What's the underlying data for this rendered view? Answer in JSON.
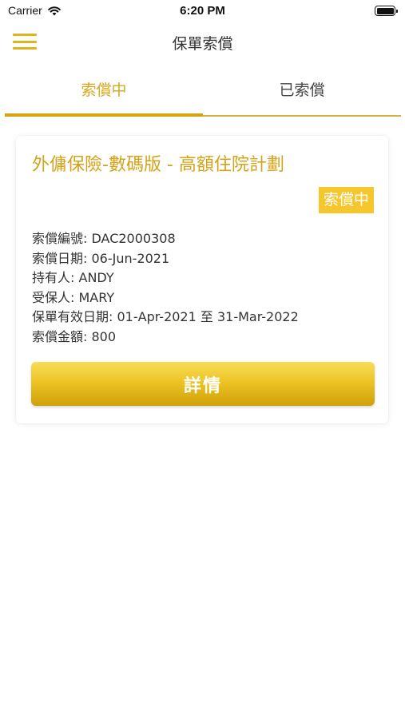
{
  "status_bar": {
    "carrier": "Carrier",
    "time": "6:20 PM",
    "wifi_icon": "wifi-icon",
    "battery_icon": "battery-icon"
  },
  "nav": {
    "menu_icon": "hamburger-menu-icon",
    "title": "保單索償"
  },
  "tabs": [
    {
      "label": "索償中",
      "active": true
    },
    {
      "label": "已索償",
      "active": false
    }
  ],
  "claims": [
    {
      "plan_title": "外傭保險-數碼版 - 高額住院計劃",
      "status_badge": "索償中",
      "rows": [
        {
          "label": "索償編號:",
          "value": "DAC2000308"
        },
        {
          "label": "索償日期:",
          "value": "06-Jun-2021"
        },
        {
          "label": "持有人:",
          "value": "ANDY"
        },
        {
          "label": "受保人:",
          "value": "MARY"
        },
        {
          "label": "保單有效日期:",
          "value": "01-Apr-2021 至 31-Mar-2022"
        },
        {
          "label": "索償金額:",
          "value": "800"
        }
      ],
      "details_button": "詳情"
    }
  ],
  "colors": {
    "accent": "#d4a31a",
    "badge": "#f6c62d",
    "button_gradient_top": "#f8dd5a",
    "button_gradient_bottom": "#cfa00b"
  }
}
